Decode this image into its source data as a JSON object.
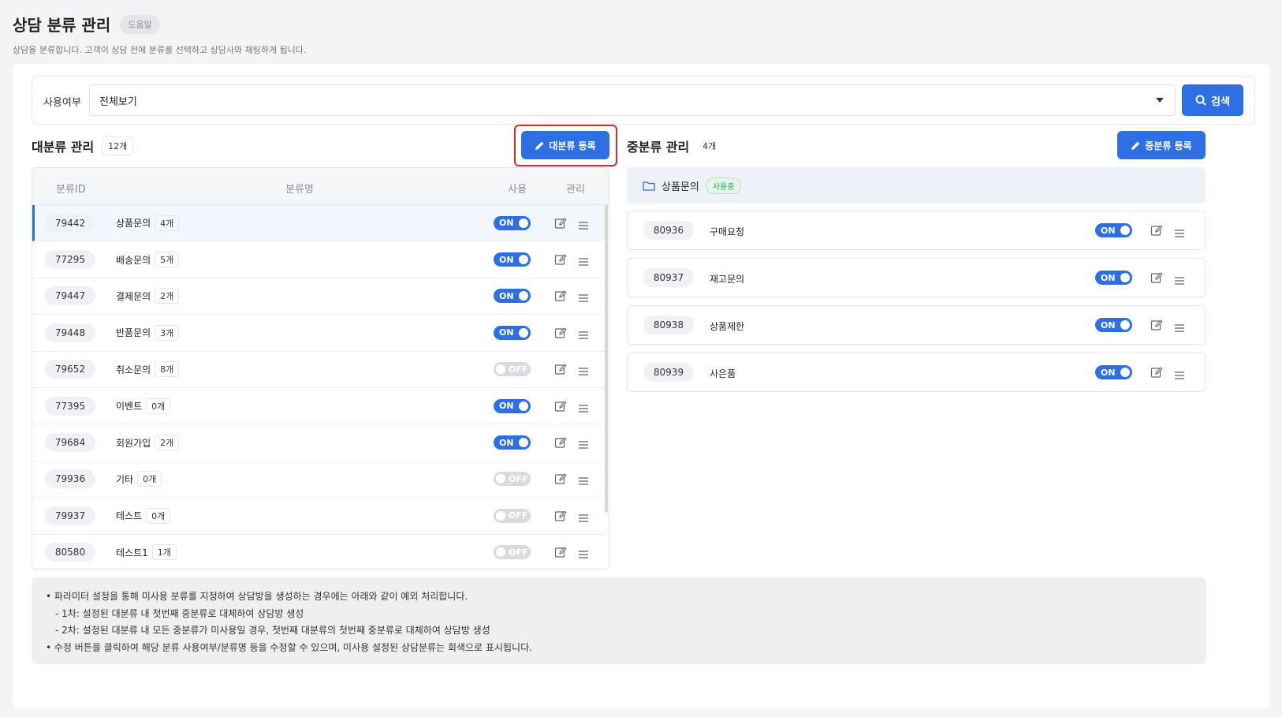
{
  "page": {
    "title": "상담 분류 관리",
    "help": "도움말",
    "description": "상담을 분류합니다. 고객이 상담 전에 분류를 선택하고 상담사와 채팅하게 됩니다."
  },
  "filter": {
    "label": "사용여부",
    "selected": "전체보기",
    "search_label": "검색"
  },
  "major": {
    "title": "대분류 관리",
    "count": "12개",
    "register_label": "대분류 등록",
    "columns": {
      "id": "분류ID",
      "name": "분류명",
      "use": "사용",
      "manage": "관리"
    },
    "rows": [
      {
        "id": "79442",
        "name": "상품문의",
        "count": "4개",
        "status": "ON"
      },
      {
        "id": "77295",
        "name": "배송문의",
        "count": "5개",
        "status": "ON"
      },
      {
        "id": "79447",
        "name": "결제문의",
        "count": "2개",
        "status": "ON"
      },
      {
        "id": "79448",
        "name": "반품문의",
        "count": "3개",
        "status": "ON"
      },
      {
        "id": "79652",
        "name": "취소문의",
        "count": "8개",
        "status": "OFF"
      },
      {
        "id": "77395",
        "name": "이벤트",
        "count": "0개",
        "status": "ON"
      },
      {
        "id": "79684",
        "name": "회원가입",
        "count": "2개",
        "status": "ON"
      },
      {
        "id": "79936",
        "name": "기타",
        "count": "0개",
        "status": "OFF"
      },
      {
        "id": "79937",
        "name": "테스트",
        "count": "0개",
        "status": "OFF"
      },
      {
        "id": "80580",
        "name": "테스트1",
        "count": "1개",
        "status": "OFF"
      }
    ]
  },
  "middle": {
    "title": "중분류 관리",
    "count": "4개",
    "register_label": "중분류 등록",
    "parent_name": "상품문의",
    "parent_status": "사용중",
    "rows": [
      {
        "id": "80936",
        "name": "구매요청",
        "status": "ON"
      },
      {
        "id": "80937",
        "name": "재고문의",
        "status": "ON"
      },
      {
        "id": "80938",
        "name": "상품제한",
        "status": "ON"
      },
      {
        "id": "80939",
        "name": "사은품",
        "status": "ON"
      }
    ]
  },
  "notice": {
    "line1": "• 파라미터 설정을 통해 미사용 분류를 지정하여 상담방을 생성하는 경우에는 아래와 같이 예외 처리합니다.",
    "line2": "- 1차: 설정된 대분류 내 첫번째 중분류로 대체하여 상담방 생성",
    "line3": "- 2차: 설정된 대분류 내 모든 중분류가 미사용일 경우, 첫번째 대분류의 첫번째 중분류로 대체하여 상담방 생성",
    "line4": "• 수정 버튼을 클릭하여 해당 분류 사용여부/분류명 등을 수정할 수 있으며, 미사용 설정된 상담분류는 회색으로 표시됩니다."
  },
  "colors": {
    "primary": "#2f6fe4",
    "highlight": "#d92a2a",
    "success": "#3d9a52"
  }
}
